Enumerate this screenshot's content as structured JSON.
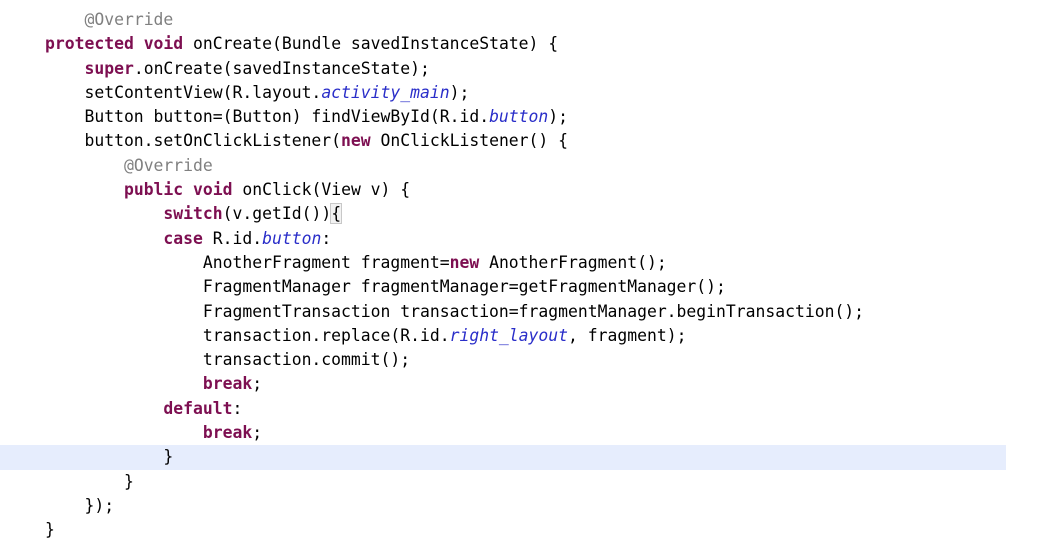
{
  "editor": {
    "language": "java",
    "background_color": "#ffffff",
    "foreground_color": "#000000",
    "current_line_highlight_color": "#e6edfd",
    "colors": {
      "keyword": "#7d0f51",
      "annotation": "#808080",
      "field_reference": "#2a2ec9",
      "plain": "#000000"
    },
    "lines": [
      {
        "index": 0,
        "current": false,
        "text": "    @Override",
        "tokens": [
          {
            "t": "    ",
            "k": "plain"
          },
          {
            "t": "@Override",
            "k": "annotation"
          }
        ]
      },
      {
        "index": 1,
        "current": false,
        "text": "protected void onCreate(Bundle savedInstanceState) {",
        "tokens": [
          {
            "t": "protected",
            "k": "keyword"
          },
          {
            "t": " ",
            "k": "plain"
          },
          {
            "t": "void",
            "k": "keyword"
          },
          {
            "t": " onCreate(Bundle savedInstanceState) {",
            "k": "plain"
          }
        ]
      },
      {
        "index": 2,
        "current": false,
        "text": "    super.onCreate(savedInstanceState);",
        "tokens": [
          {
            "t": "    ",
            "k": "plain"
          },
          {
            "t": "super",
            "k": "keyword"
          },
          {
            "t": ".onCreate(savedInstanceState);",
            "k": "plain"
          }
        ]
      },
      {
        "index": 3,
        "current": false,
        "text": "    setContentView(R.layout.activity_main);",
        "tokens": [
          {
            "t": "    setContentView(R.layout.",
            "k": "plain"
          },
          {
            "t": "activity_main",
            "k": "field"
          },
          {
            "t": ");",
            "k": "plain"
          }
        ]
      },
      {
        "index": 4,
        "current": false,
        "text": "    Button button=(Button) findViewById(R.id.button);",
        "tokens": [
          {
            "t": "    Button button=(Button) findViewById(R.id.",
            "k": "plain"
          },
          {
            "t": "button",
            "k": "field"
          },
          {
            "t": ");",
            "k": "plain"
          }
        ]
      },
      {
        "index": 5,
        "current": false,
        "text": "    button.setOnClickListener(new OnClickListener() {",
        "tokens": [
          {
            "t": "    button.setOnClickListener(",
            "k": "plain"
          },
          {
            "t": "new",
            "k": "keyword"
          },
          {
            "t": " OnClickListener() {",
            "k": "plain"
          }
        ]
      },
      {
        "index": 6,
        "current": false,
        "text": "        @Override",
        "tokens": [
          {
            "t": "        ",
            "k": "plain"
          },
          {
            "t": "@Override",
            "k": "annotation"
          }
        ]
      },
      {
        "index": 7,
        "current": false,
        "text": "        public void onClick(View v) {",
        "tokens": [
          {
            "t": "        ",
            "k": "plain"
          },
          {
            "t": "public",
            "k": "keyword"
          },
          {
            "t": " ",
            "k": "plain"
          },
          {
            "t": "void",
            "k": "keyword"
          },
          {
            "t": " onClick(View v) {",
            "k": "plain"
          }
        ]
      },
      {
        "index": 8,
        "current": false,
        "text": "            switch(v.getId()){",
        "tokens": [
          {
            "t": "            ",
            "k": "plain"
          },
          {
            "t": "switch",
            "k": "keyword"
          },
          {
            "t": "(v.getId())",
            "k": "plain"
          },
          {
            "t": "{",
            "k": "bracket-hl"
          }
        ]
      },
      {
        "index": 9,
        "current": false,
        "text": "            case R.id.button:",
        "tokens": [
          {
            "t": "            ",
            "k": "plain"
          },
          {
            "t": "case",
            "k": "keyword"
          },
          {
            "t": " R.id.",
            "k": "plain"
          },
          {
            "t": "button",
            "k": "field"
          },
          {
            "t": ":",
            "k": "plain"
          }
        ]
      },
      {
        "index": 10,
        "current": false,
        "text": "                AnotherFragment fragment=new AnotherFragment();",
        "tokens": [
          {
            "t": "                AnotherFragment fragment=",
            "k": "plain"
          },
          {
            "t": "new",
            "k": "keyword"
          },
          {
            "t": " AnotherFragment();",
            "k": "plain"
          }
        ]
      },
      {
        "index": 11,
        "current": false,
        "text": "                FragmentManager fragmentManager=getFragmentManager();",
        "tokens": [
          {
            "t": "                FragmentManager fragmentManager=getFragmentManager();",
            "k": "plain"
          }
        ]
      },
      {
        "index": 12,
        "current": false,
        "text": "                FragmentTransaction transaction=fragmentManager.beginTransaction();",
        "tokens": [
          {
            "t": "                FragmentTransaction transaction=fragmentManager.beginTransaction();",
            "k": "plain"
          }
        ]
      },
      {
        "index": 13,
        "current": false,
        "text": "                transaction.replace(R.id.right_layout, fragment);",
        "tokens": [
          {
            "t": "                transaction.replace(R.id.",
            "k": "plain"
          },
          {
            "t": "right_layout",
            "k": "field"
          },
          {
            "t": ", fragment);",
            "k": "plain"
          }
        ]
      },
      {
        "index": 14,
        "current": false,
        "text": "                transaction.commit();",
        "tokens": [
          {
            "t": "                transaction.commit();",
            "k": "plain"
          }
        ]
      },
      {
        "index": 15,
        "current": false,
        "text": "                break;",
        "tokens": [
          {
            "t": "                ",
            "k": "plain"
          },
          {
            "t": "break",
            "k": "keyword"
          },
          {
            "t": ";",
            "k": "plain"
          }
        ]
      },
      {
        "index": 16,
        "current": false,
        "text": "            default:",
        "tokens": [
          {
            "t": "            ",
            "k": "plain"
          },
          {
            "t": "default",
            "k": "keyword"
          },
          {
            "t": ":",
            "k": "plain"
          }
        ]
      },
      {
        "index": 17,
        "current": false,
        "text": "                break;",
        "tokens": [
          {
            "t": "                ",
            "k": "plain"
          },
          {
            "t": "break",
            "k": "keyword"
          },
          {
            "t": ";",
            "k": "plain"
          }
        ]
      },
      {
        "index": 18,
        "current": true,
        "text": "            }",
        "tokens": [
          {
            "t": "            }",
            "k": "plain"
          }
        ]
      },
      {
        "index": 19,
        "current": false,
        "text": "        }",
        "tokens": [
          {
            "t": "        }",
            "k": "plain"
          }
        ]
      },
      {
        "index": 20,
        "current": false,
        "text": "    });",
        "tokens": [
          {
            "t": "    });",
            "k": "plain"
          }
        ]
      },
      {
        "index": 21,
        "current": false,
        "text": "}",
        "tokens": [
          {
            "t": "}",
            "k": "plain"
          }
        ]
      }
    ]
  }
}
